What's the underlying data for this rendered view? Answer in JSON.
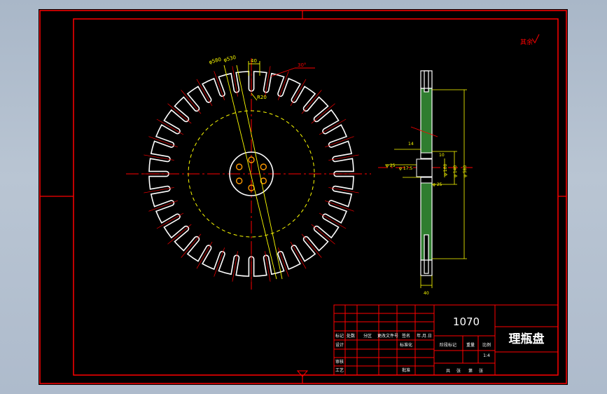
{
  "colors": {
    "background": "#000000",
    "frame": "#ff0000",
    "outline": "#ffffff",
    "dimension": "#ffff00",
    "center_line": "#ff0000",
    "section_fill": "#2f7d2f",
    "hole": "#ff9900",
    "window_bg": "#b3c0cf"
  },
  "drawing": {
    "teeth_count": 36,
    "hole_count": 6,
    "corner_note": "其余",
    "gear_dims": {
      "d_outer": "φ580",
      "d_root": "φ530",
      "slot_width": "40",
      "chamfer": "30°",
      "radius": "R20"
    },
    "side_dims": {
      "hub_left": "14",
      "hub_right": "10",
      "d_hole_a": "φ 25",
      "d_hole_b": "φ 17.5",
      "d_hole_c": "φ 25",
      "d_hub": "φ 100",
      "d_pcd": "φ 140",
      "d_disc": "φ 580",
      "thickness": "40"
    }
  },
  "title_block": {
    "drawing_number": "1070",
    "part_name": "理瓶盘",
    "rows": [
      [
        "标记",
        "处数",
        "分区",
        "更改文件号",
        "签名",
        "年.月.日"
      ],
      [
        "设计",
        "",
        "标准化",
        "",
        "阶段标记",
        "重量",
        "比例"
      ],
      [
        "审核",
        "",
        "",
        "",
        "",
        "",
        "1:4"
      ],
      [
        "工艺",
        "",
        "批准",
        "",
        "共",
        "张",
        "第",
        "张"
      ]
    ]
  }
}
